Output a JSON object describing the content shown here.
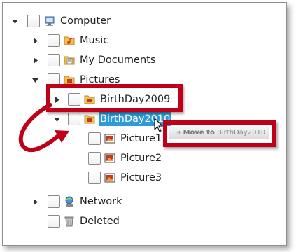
{
  "tree": {
    "items": [
      {
        "label": "Computer",
        "icon": "computer-icon",
        "state": "expanded"
      },
      {
        "label": "Music",
        "icon": "music-folder-icon",
        "state": "collapsed"
      },
      {
        "label": "My Documents",
        "icon": "documents-folder-icon",
        "state": "collapsed"
      },
      {
        "label": "Pictures",
        "icon": "pictures-folder-icon",
        "state": "expanded"
      },
      {
        "label": "BirthDay2009",
        "icon": "folder-icon",
        "state": "collapsed"
      },
      {
        "label": "BirthDay2010",
        "icon": "folder-icon",
        "state": "expanded",
        "selected": true
      },
      {
        "label": "Picture1",
        "icon": "picture-icon",
        "state": "leaf"
      },
      {
        "label": "Picture2",
        "icon": "picture-icon",
        "state": "leaf"
      },
      {
        "label": "Picture3",
        "icon": "picture-icon",
        "state": "leaf"
      },
      {
        "label": "Network",
        "icon": "network-icon",
        "state": "collapsed"
      },
      {
        "label": "Deleted",
        "icon": "recycle-bin-icon",
        "state": "leaf"
      }
    ]
  },
  "drag_tooltip": {
    "arrow": "→",
    "prefix": "Move to",
    "target": "BirthDay2010"
  },
  "colors": {
    "selection": "#2d9bd8",
    "highlight_frame": "#c00018"
  }
}
